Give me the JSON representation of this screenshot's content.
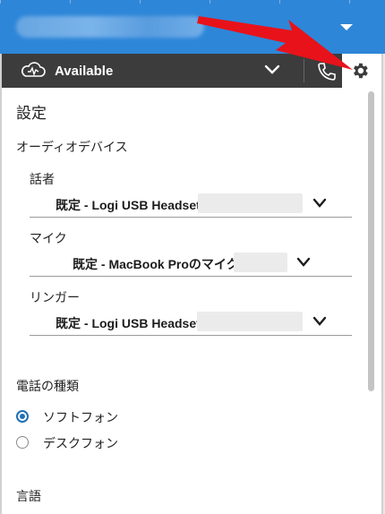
{
  "header": {
    "caret": "dropdown"
  },
  "status_bar": {
    "status": "Available"
  },
  "settings": {
    "title": "設定",
    "audio_devices": {
      "heading": "オーディオデバイス",
      "speaker": {
        "label": "話者",
        "value": "既定 - Logi USB Headset"
      },
      "microphone": {
        "label": "マイク",
        "value": "既定 - MacBook Proのマイク"
      },
      "ringer": {
        "label": "リンガー",
        "value": "既定 - Logi USB Headset"
      }
    },
    "phone_type": {
      "heading": "電話の種類",
      "options": [
        {
          "label": "ソフトフォン",
          "selected": true
        },
        {
          "label": "デスクフォン",
          "selected": false
        }
      ]
    },
    "language": {
      "heading": "言語"
    }
  },
  "colors": {
    "topbar": "#2e86d8",
    "statusbar": "#3c3c3c",
    "accent": "#1f6fb5",
    "annotation_arrow": "#e8121a"
  }
}
